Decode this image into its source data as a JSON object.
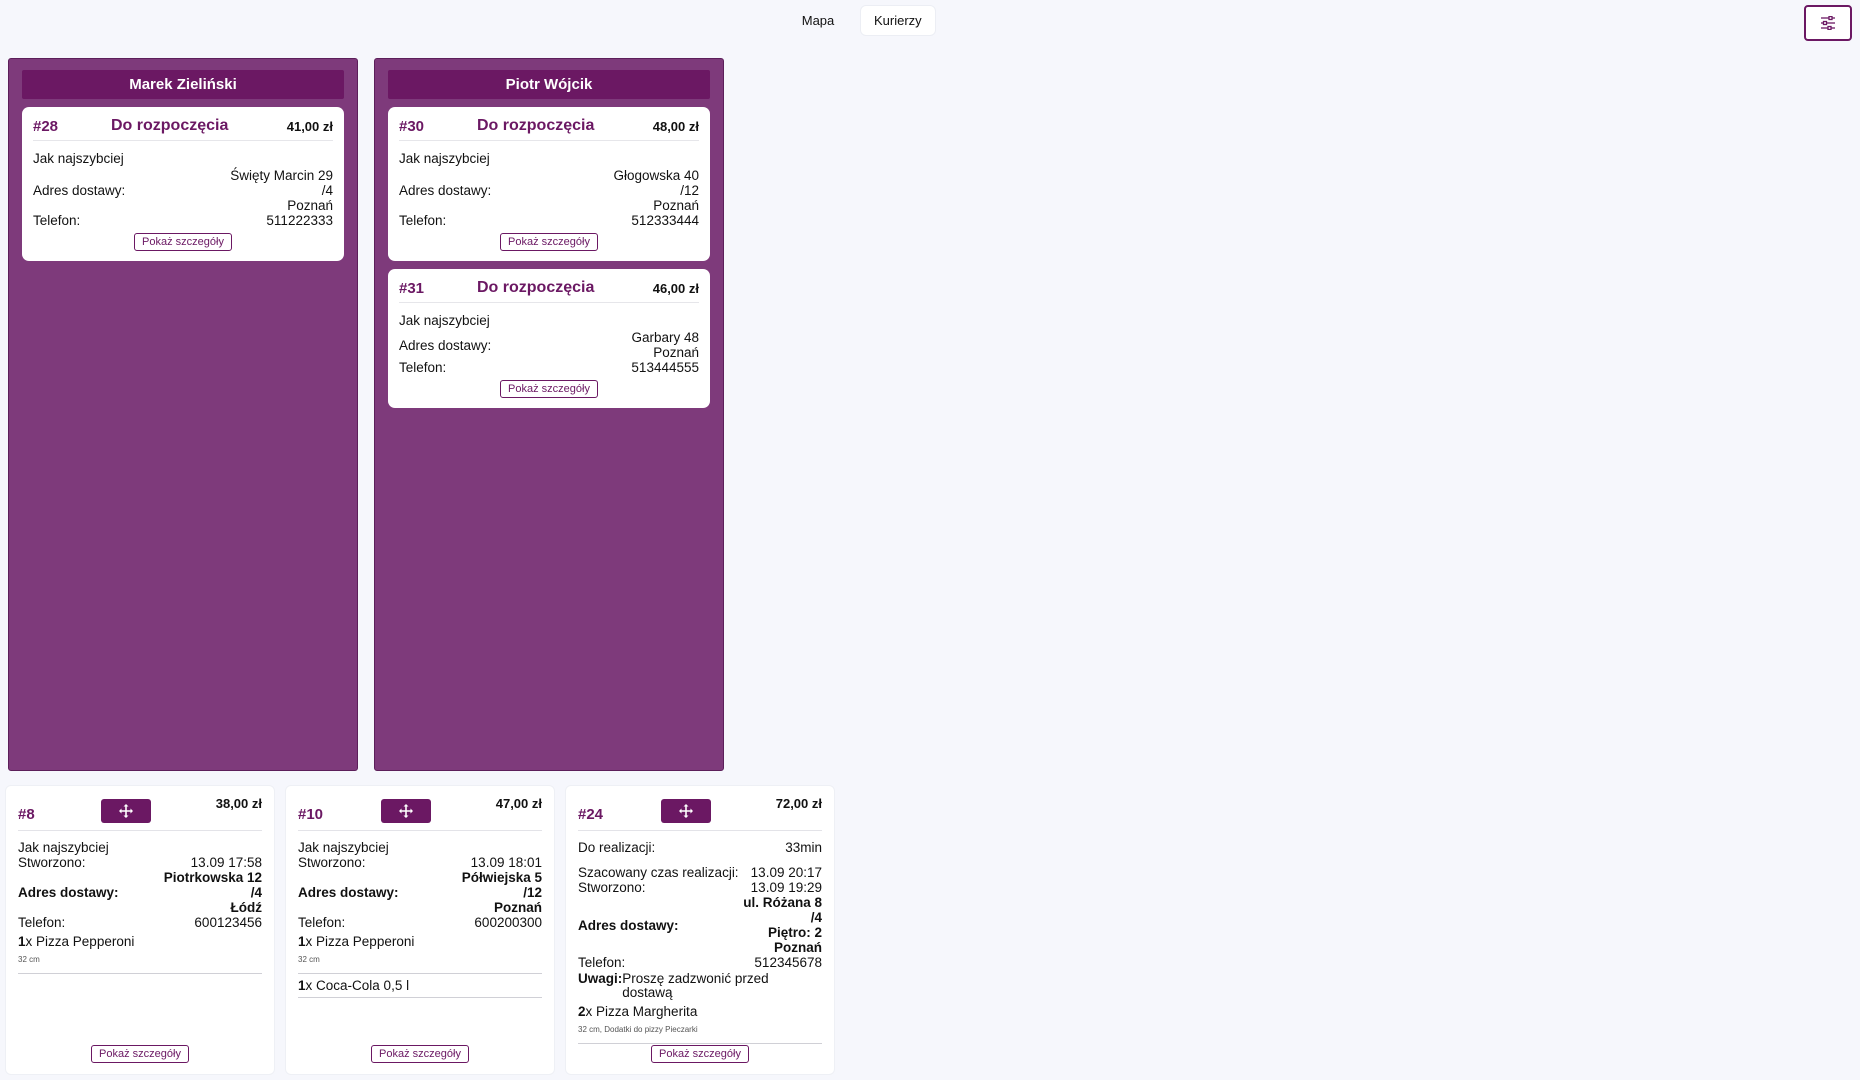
{
  "top_tabs": [
    "Mapa",
    "Kurierzy"
  ],
  "settings_icon": "sliders-icon",
  "details_label": "Pokaż szczegóły",
  "couriers": [
    {
      "name": "Marek Zieliński",
      "orders": [
        {
          "number": "#28",
          "status": "Do rozpoczęcia",
          "price": "41,00 zł",
          "timing": "Jak najszybciej",
          "address_label": "Adres dostawy:",
          "address": [
            "Święty Marcin 29",
            "/4",
            "Poznań"
          ],
          "phone_label": "Telefon:",
          "phone": "511222333"
        }
      ]
    },
    {
      "name": "Piotr Wójcik",
      "orders": [
        {
          "number": "#30",
          "status": "Do rozpoczęcia",
          "price": "48,00 zł",
          "timing": "Jak najszybciej",
          "address_label": "Adres dostawy:",
          "address": [
            "Głogowska 40",
            "/12",
            "Poznań"
          ],
          "phone_label": "Telefon:",
          "phone": "512333444"
        },
        {
          "number": "#31",
          "status": "Do rozpoczęcia",
          "price": "46,00 zł",
          "timing": "Jak najszybciej",
          "address_label": "Adres dostawy:",
          "address": [
            "Garbary 48",
            "Poznań"
          ],
          "phone_label": "Telefon:",
          "phone": "513444555"
        }
      ]
    }
  ],
  "unassigned": [
    {
      "number": "#8",
      "price": "38,00 zł",
      "timing": "Jak najszybciej",
      "created_label": "Stworzono:",
      "created": "13.09 17:58",
      "address_label": "Adres dostawy:",
      "address": [
        "Piotrkowska 12",
        "/4",
        "Łódź"
      ],
      "phone_label": "Telefon:",
      "phone": "600123456",
      "items": [
        {
          "qty": "1",
          "x": "x",
          "name": "Pizza Pepperoni",
          "sub": "32 cm"
        }
      ]
    },
    {
      "number": "#10",
      "price": "47,00 zł",
      "timing": "Jak najszybciej",
      "created_label": "Stworzono:",
      "created": "13.09 18:01",
      "address_label": "Adres dostawy:",
      "address": [
        "Półwiejska 5",
        "/12",
        "Poznań"
      ],
      "phone_label": "Telefon:",
      "phone": "600200300",
      "items": [
        {
          "qty": "1",
          "x": "x",
          "name": "Pizza Pepperoni",
          "sub": "32 cm"
        },
        {
          "qty": "1",
          "x": "x",
          "name": "Coca-Cola 0,5 l",
          "sub": ""
        }
      ]
    },
    {
      "number": "#24",
      "price": "72,00 zł",
      "remaining_label": "Do realizacji:",
      "remaining": "33min",
      "estimate_label": "Szacowany czas realizacji:",
      "estimate": "13.09 20:17",
      "created_label": "Stworzono:",
      "created": "13.09 19:29",
      "address_label": "Adres dostawy:",
      "address": [
        "ul. Różana 8",
        "/4",
        "Piętro: 2",
        "Poznań"
      ],
      "phone_label": "Telefon:",
      "phone": "512345678",
      "notes_label": "Uwagi:",
      "notes": "Proszę zadzwonić przed dostawą",
      "items": [
        {
          "qty": "2",
          "x": "x",
          "name": "Pizza Margherita",
          "sub": "32 cm, Dodatki do pizzy Pieczarki"
        }
      ]
    }
  ]
}
